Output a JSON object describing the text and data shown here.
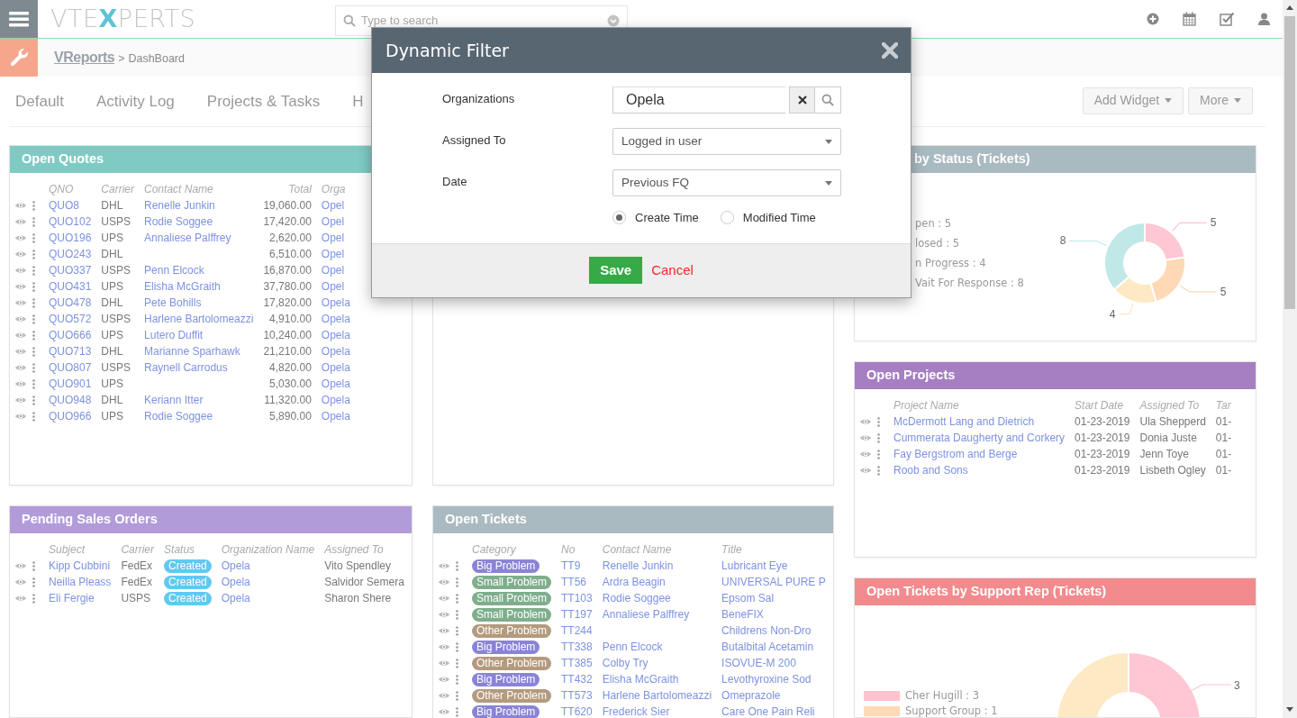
{
  "topbar": {
    "logo": {
      "lead": "VTE",
      "mark": "X",
      "tail": "PERTS"
    },
    "search": {
      "placeholder": "Type to search"
    }
  },
  "breadcrumb": {
    "module": "VReports",
    "separator": ">",
    "page": "DashBoard"
  },
  "tabs": [
    {
      "label": "Default"
    },
    {
      "label": "Activity Log"
    },
    {
      "label": "Projects & Tasks"
    },
    {
      "label": "H"
    }
  ],
  "actions": [
    {
      "label": "Add Widget"
    },
    {
      "label": "More"
    }
  ],
  "columns": [
    {
      "widgets": [
        {
          "kind": "table",
          "title": "Open Quotes",
          "color": "#7fcbc4",
          "columns": [
            {
              "label": "QNO",
              "kind": "link"
            },
            {
              "label": "Carrier",
              "kind": "plain"
            },
            {
              "label": "Contact Name",
              "kind": "link"
            },
            {
              "label": "Total",
              "kind": "number"
            },
            {
              "label": "Orga",
              "kind": "link"
            }
          ],
          "rows": [
            [
              "QUO8",
              "DHL",
              "Renelle Junkin",
              "19,060.00",
              "Opel"
            ],
            [
              "QUO102",
              "USPS",
              "Rodie Soggee",
              "17,420.00",
              "Opel"
            ],
            [
              "QUO196",
              "UPS",
              "Annaliese Palffrey",
              "2,620.00",
              "Opel"
            ],
            [
              "QUO243",
              "DHL",
              null,
              "6,510.00",
              "Opel"
            ],
            [
              "QUO337",
              "USPS",
              "Penn Elcock",
              "16,870.00",
              "Opel"
            ],
            [
              "QUO431",
              "UPS",
              "Elisha McGraith",
              "37,780.00",
              "Opel"
            ],
            [
              "QUO478",
              "DHL",
              "Pete Bohills",
              "17,820.00",
              "Opela"
            ],
            [
              "QUO572",
              "USPS",
              "Harlene Bartolomeazzi",
              "4,910.00",
              "Opela"
            ],
            [
              "QUO666",
              "UPS",
              "Lutero Duffit",
              "10,240.00",
              "Opela"
            ],
            [
              "QUO713",
              "DHL",
              "Marianne Sparhawk",
              "21,210.00",
              "Opela"
            ],
            [
              "QUO807",
              "USPS",
              "Raynell Carrodus",
              "4,820.00",
              "Opela"
            ],
            [
              "QUO901",
              "UPS",
              null,
              "5,030.00",
              "Opela"
            ],
            [
              "QUO948",
              "DHL",
              "Keriann Itter",
              "11,320.00",
              "Opela"
            ],
            [
              "QUO966",
              "UPS",
              "Rodie Soggee",
              "5,890.00",
              "Opela"
            ]
          ]
        },
        {
          "kind": "table",
          "title": "Pending Sales Orders",
          "color": "#b19cd9",
          "columns": [
            {
              "label": "Subject",
              "kind": "link"
            },
            {
              "label": "Carrier",
              "kind": "plain"
            },
            {
              "label": "Status",
              "kind": "badge"
            },
            {
              "label": "Organization Name",
              "kind": "link"
            },
            {
              "label": "Assigned To",
              "kind": "plain"
            }
          ],
          "rows": [
            [
              "Kipp Cubbini",
              "FedEx",
              {
                "text": "Created",
                "color": "#62c8f2"
              },
              "Opela",
              "Vito Spendley"
            ],
            [
              "Neilla Pleass",
              "FedEx",
              {
                "text": "Created",
                "color": "#62c8f2"
              },
              "Opela",
              "Salvidor Semera"
            ],
            [
              "Eli Fergie",
              "USPS",
              {
                "text": "Created",
                "color": "#62c8f2"
              },
              "Opela",
              "Sharon Shere"
            ]
          ]
        }
      ]
    },
    {
      "widgets": [
        {
          "kind": "blank"
        },
        {
          "kind": "table",
          "title": "Open Tickets",
          "color": "#aabac1",
          "columns": [
            {
              "label": "Category",
              "kind": "badge"
            },
            {
              "label": "No",
              "kind": "link"
            },
            {
              "label": "Contact Name",
              "kind": "link"
            },
            {
              "label": "Title",
              "kind": "link"
            }
          ],
          "rows": [
            [
              {
                "text": "Big Problem",
                "color": "#8a84d6"
              },
              "TT9",
              "Renelle Junkin",
              "Lubricant Eye"
            ],
            [
              {
                "text": "Small Problem",
                "color": "#7fae8c"
              },
              "TT56",
              "Ardra Beagin",
              "UNIVERSAL PURE P"
            ],
            [
              {
                "text": "Small Problem",
                "color": "#7fae8c"
              },
              "TT103",
              "Rodie Soggee",
              "Epsom Sal"
            ],
            [
              {
                "text": "Small Problem",
                "color": "#7fae8c"
              },
              "TT197",
              "Annaliese Palffrey",
              "BeneFIX"
            ],
            [
              {
                "text": "Other Problem",
                "color": "#b49a7e"
              },
              "TT244",
              null,
              "Childrens Non-Dro"
            ],
            [
              {
                "text": "Big Problem",
                "color": "#8a84d6"
              },
              "TT338",
              "Penn Elcock",
              "Butalbital Acetamin"
            ],
            [
              {
                "text": "Other Problem",
                "color": "#b49a7e"
              },
              "TT385",
              "Colby Try",
              "ISOVUE-M 200"
            ],
            [
              {
                "text": "Big Problem",
                "color": "#8a84d6"
              },
              "TT432",
              "Elisha McGraith",
              "Levothyroxine Sod"
            ],
            [
              {
                "text": "Other Problem",
                "color": "#b49a7e"
              },
              "TT573",
              "Harlene Bartolomeazzi",
              "Omeprazole"
            ],
            [
              {
                "text": "Big Problem",
                "color": "#8a84d6"
              },
              "TT620",
              "Frederick Sier",
              "Care One Pain Reli"
            ]
          ]
        }
      ]
    },
    {
      "widgets": [
        {
          "kind": "donut",
          "title": "by Status (Tickets)",
          "color": "#aabac1",
          "legend": [
            "pen : 5",
            "losed : 5",
            "n Progress : 4",
            "Vait For Response : 8"
          ],
          "chart_data": {
            "type": "donut",
            "values": [
              5,
              5,
              4,
              8
            ],
            "data_labels": true
          }
        },
        {
          "kind": "table",
          "title": "Open Projects",
          "color": "#a57fc2",
          "columns": [
            {
              "label": "Project Name",
              "kind": "link"
            },
            {
              "label": "Start Date",
              "kind": "plain"
            },
            {
              "label": "Assigned To",
              "kind": "plain"
            },
            {
              "label": "Tar",
              "kind": "plain"
            }
          ],
          "rows": [
            [
              "McDermott Lang and Dietrich",
              "01-23-2019",
              "Ula Shepperd",
              "01-"
            ],
            [
              "Cummerata Daugherty and Corkery",
              "01-23-2019",
              "Donia Juste",
              "01-"
            ],
            [
              "Fay Bergstrom and Berge",
              "01-23-2019",
              "Jenn Toye",
              "01-"
            ],
            [
              "Roob and Sons",
              "01-23-2019",
              "Lisbeth Ogley",
              "01-"
            ]
          ]
        },
        {
          "kind": "donut_partial",
          "title": "Open Tickets by Support Rep (Tickets)",
          "color": "#f28b8e",
          "legend": [
            {
              "label": "Cher Hugill : 3",
              "color": "#ffc2cf"
            },
            {
              "label": "Support Group : 1",
              "color": "#ffd8b5"
            }
          ],
          "callout": "3"
        }
      ]
    }
  ],
  "dialog": {
    "title": "Dynamic Filter",
    "fields": [
      {
        "label": "Organizations",
        "kind": "lookup",
        "value": "Opela"
      },
      {
        "label": "Assigned To",
        "kind": "select",
        "value": "Logged in user"
      },
      {
        "label": "Date",
        "kind": "select",
        "value": "Previous FQ"
      }
    ],
    "options": [
      {
        "label": "Create Time",
        "selected": true
      },
      {
        "label": "Modified Time",
        "selected": false
      }
    ],
    "save": "Save",
    "cancel": "Cancel"
  }
}
